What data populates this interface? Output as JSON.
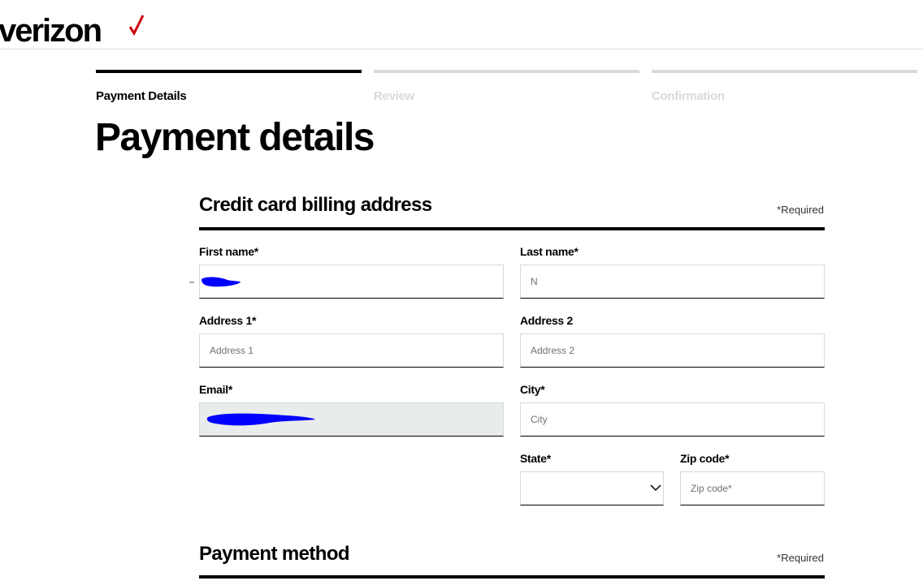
{
  "header": {
    "brand": "verizon"
  },
  "steps": [
    {
      "label": "Payment Details",
      "active": true
    },
    {
      "label": "Review",
      "active": false
    },
    {
      "label": "Confirmation",
      "active": false
    }
  ],
  "page_title": "Payment details",
  "billing": {
    "title": "Credit card billing address",
    "required_note": "*Required",
    "first_name": {
      "label": "First name*",
      "value": ""
    },
    "last_name": {
      "label": "Last name*",
      "value": "N"
    },
    "address1": {
      "label": "Address 1*",
      "placeholder": "Address 1"
    },
    "address2": {
      "label": "Address 2",
      "placeholder": "Address 2"
    },
    "email": {
      "label": "Email*",
      "value": ""
    },
    "city": {
      "label": "City*",
      "placeholder": "City"
    },
    "state": {
      "label": "State*",
      "value": ""
    },
    "zip": {
      "label": "Zip code*",
      "placeholder": "Zip code*"
    }
  },
  "payment": {
    "title": "Payment method",
    "required_note": "*Required"
  },
  "colors": {
    "accent": "#cd040b",
    "rule": "#000000",
    "inactive": "#d8dada",
    "redaction": "#0000ff"
  }
}
